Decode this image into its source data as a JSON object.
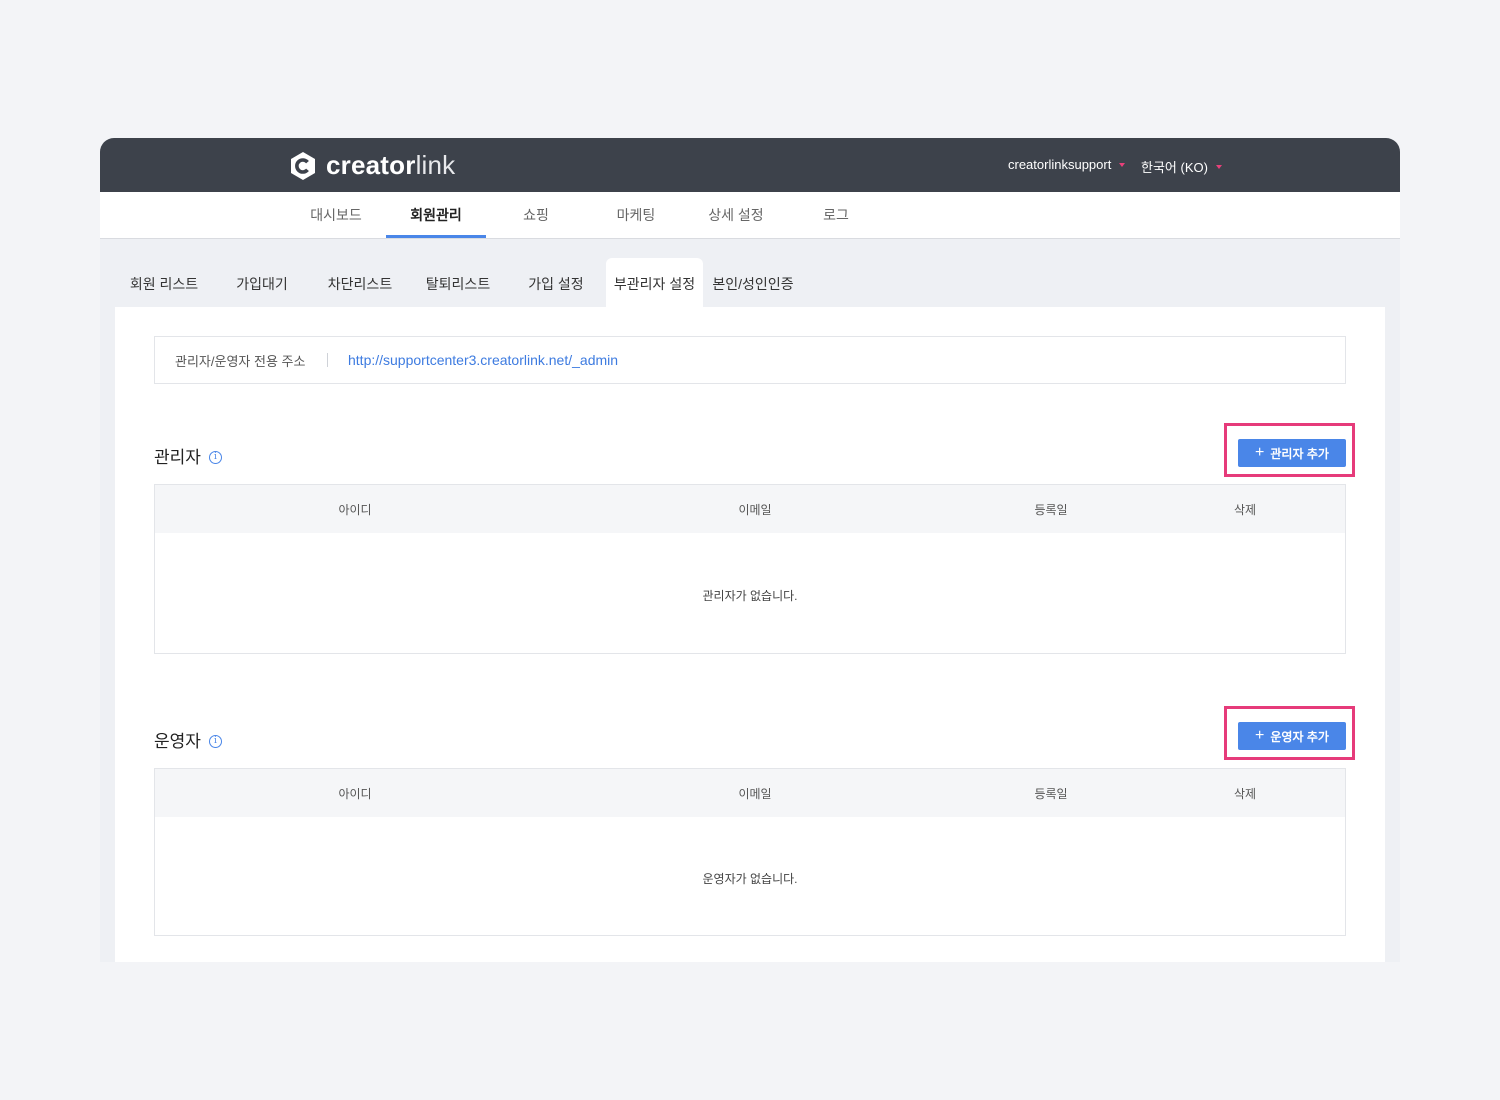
{
  "brand": {
    "logo_bold": "creator",
    "logo_light": "link"
  },
  "header": {
    "user": "creatorlinksupport",
    "language": "한국어 (KO)"
  },
  "colors": {
    "accent": "#4a86e8",
    "highlight": "#e63b7a",
    "topbar": "#3d424b"
  },
  "main_nav": [
    {
      "label": "대시보드"
    },
    {
      "label": "회원관리",
      "active": true
    },
    {
      "label": "쇼핑"
    },
    {
      "label": "마케팅"
    },
    {
      "label": "상세 설정"
    },
    {
      "label": "로그"
    }
  ],
  "sub_tabs": [
    {
      "label": "회원 리스트"
    },
    {
      "label": "가입대기"
    },
    {
      "label": "차단리스트"
    },
    {
      "label": "탈퇴리스트"
    },
    {
      "label": "가입 설정"
    },
    {
      "label": "부관리자 설정",
      "active": true
    },
    {
      "label": "본인/성인인증"
    }
  ],
  "admin_url": {
    "label": "관리자/운영자 전용 주소",
    "url": "http://supportcenter3.creatorlink.net/_admin"
  },
  "admins": {
    "title": "관리자",
    "info_icon": "info-icon",
    "add_button": "관리자 추가",
    "columns": [
      "아이디",
      "이메일",
      "등록일",
      "삭제"
    ],
    "empty_text": "관리자가 없습니다."
  },
  "operators": {
    "title": "운영자",
    "info_icon": "info-icon",
    "add_button": "운영자 추가",
    "columns": [
      "아이디",
      "이메일",
      "등록일",
      "삭제"
    ],
    "empty_text": "운영자가 없습니다."
  }
}
